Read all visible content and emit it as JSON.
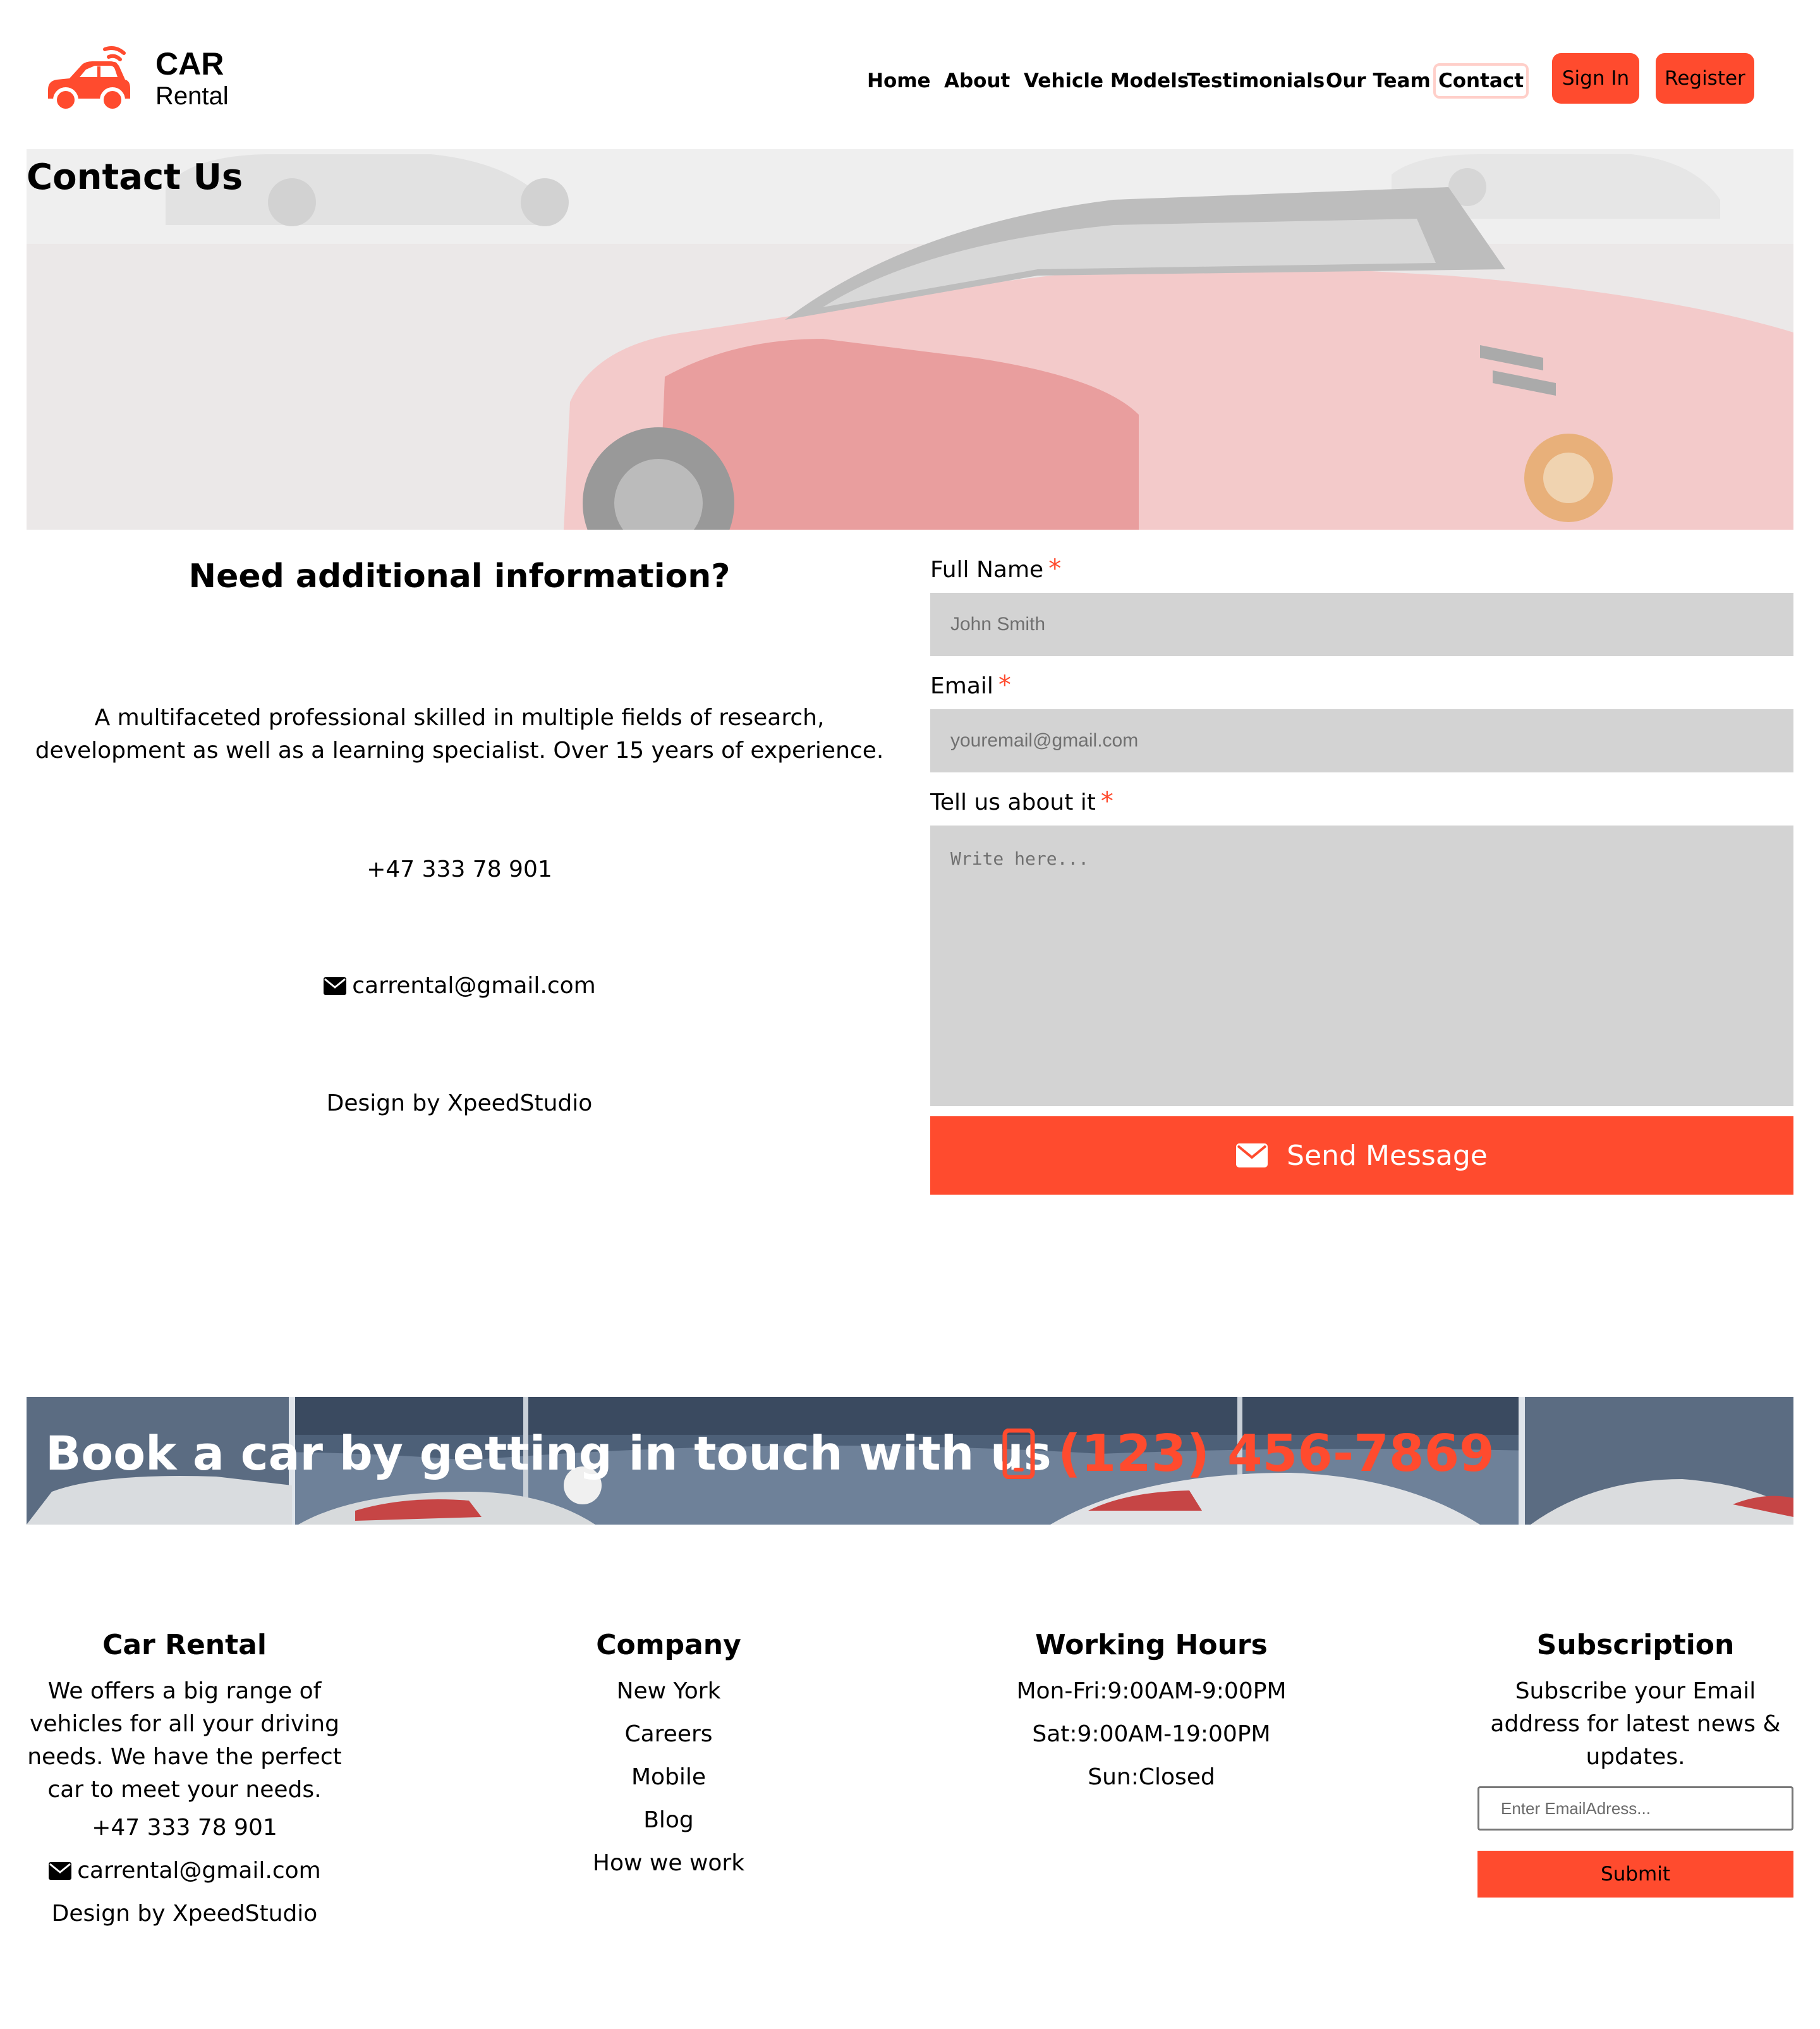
{
  "brand": {
    "name_bold": "CAR",
    "name_sub": "Rental",
    "accent": "#ff4b2e"
  },
  "nav": {
    "items": [
      "Home",
      "About",
      "Vehicle Models",
      "Testimonials",
      "Our Team",
      "Contact"
    ],
    "active": "Contact",
    "sign_in": "Sign In",
    "register": "Register"
  },
  "hero": {
    "title": "Contact Us"
  },
  "info": {
    "heading": "Need additional information?",
    "description": "A multifaceted professional skilled in multiple fields of research, development as well as a learning specialist. Over 15 years of experience.",
    "phone": "+47 333 78 901",
    "email": "carrental@gmail.com",
    "email_icon": "envelope-icon",
    "design": "Design by XpeedStudio"
  },
  "form": {
    "name_label": "Full Name",
    "name_placeholder": "John Smith",
    "email_label": "Email",
    "email_placeholder": "youremail@gmail.com",
    "message_label": "Tell us about it",
    "message_placeholder": "Write here...",
    "required_mark": "*",
    "send_label": "Send Message",
    "send_icon": "envelope-icon"
  },
  "banner": {
    "title": "Book a car by getting in touch with us",
    "phone": "(123) 456-7869",
    "phone_icon": "mobile-phone-icon"
  },
  "footer": {
    "about": {
      "title": "Car Rental",
      "text": "We offers a big range of vehicles for all your driving needs. We have the perfect car to meet your needs.",
      "phone": "+47 333 78 901",
      "email": "carrental@gmail.com",
      "design": "Design by XpeedStudio"
    },
    "company": {
      "title": "Company",
      "links": [
        "New York",
        "Careers",
        "Mobile",
        "Blog",
        "How we work"
      ]
    },
    "hours": {
      "title": "Working Hours",
      "lines": [
        "Mon-Fri:9:00AM-9:00PM",
        "Sat:9:00AM-19:00PM",
        "Sun:Closed"
      ]
    },
    "subscription": {
      "title": "Subscription",
      "text": "Subscribe your Email address for latest news & updates.",
      "placeholder": "Enter EmailAdress...",
      "submit": "Submit"
    }
  }
}
